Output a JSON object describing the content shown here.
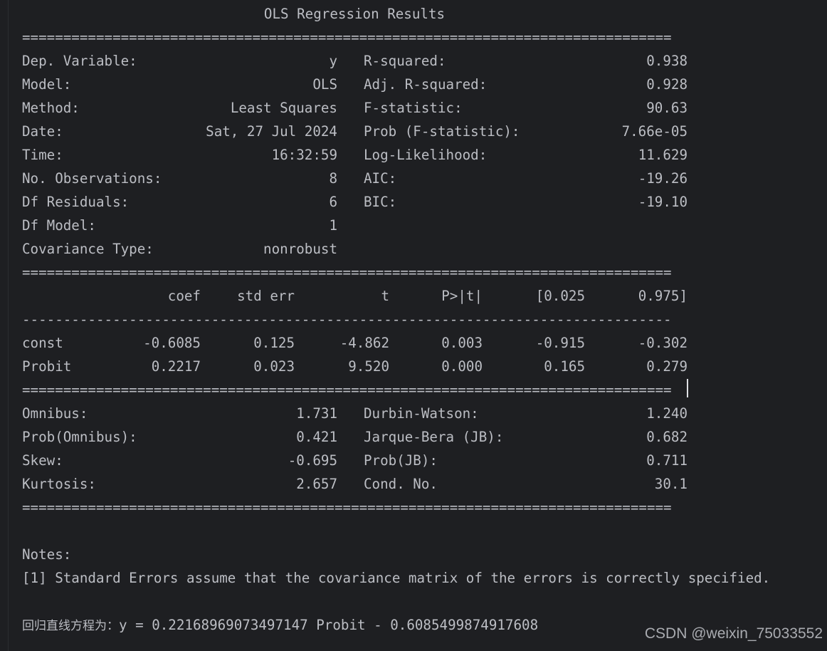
{
  "colors": {
    "background": "#1e1f22",
    "text": "#bcbec4",
    "gutter": "#2b2d30",
    "cursor": "#dfe1e5",
    "watermark": "#a9abb0"
  },
  "title": "OLS Regression Results",
  "separator_double": "===============================================================================",
  "separator_single": "-------------------------------------------------------------------------------",
  "summary": {
    "left": [
      {
        "label": "Dep. Variable:",
        "value": "y"
      },
      {
        "label": "Model:",
        "value": "OLS"
      },
      {
        "label": "Method:",
        "value": "Least Squares"
      },
      {
        "label": "Date:",
        "value": "Sat, 27 Jul 2024"
      },
      {
        "label": "Time:",
        "value": "16:32:59"
      },
      {
        "label": "No. Observations:",
        "value": "8"
      },
      {
        "label": "Df Residuals:",
        "value": "6"
      },
      {
        "label": "Df Model:",
        "value": "1"
      },
      {
        "label": "Covariance Type:",
        "value": "nonrobust"
      }
    ],
    "right": [
      {
        "label": "R-squared:",
        "value": "0.938"
      },
      {
        "label": "Adj. R-squared:",
        "value": "0.928"
      },
      {
        "label": "F-statistic:",
        "value": "90.63"
      },
      {
        "label": "Prob (F-statistic):",
        "value": "7.66e-05"
      },
      {
        "label": "Log-Likelihood:",
        "value": "11.629"
      },
      {
        "label": "AIC:",
        "value": "-19.26"
      },
      {
        "label": "BIC:",
        "value": "-19.10"
      }
    ]
  },
  "coef_table": {
    "headers": [
      "coef",
      "std err",
      "t",
      "P>|t|",
      "[0.025",
      "0.975]"
    ],
    "rows": [
      {
        "name": "const",
        "values": [
          "-0.6085",
          "0.125",
          "-4.862",
          "0.003",
          "-0.915",
          "-0.302"
        ]
      },
      {
        "name": "Probit",
        "values": [
          "0.2217",
          "0.023",
          "9.520",
          "0.000",
          "0.165",
          "0.279"
        ]
      }
    ]
  },
  "diagnostics": {
    "left": [
      {
        "label": "Omnibus:",
        "value": "1.731"
      },
      {
        "label": "Prob(Omnibus):",
        "value": "0.421"
      },
      {
        "label": "Skew:",
        "value": "-0.695"
      },
      {
        "label": "Kurtosis:",
        "value": "2.657"
      }
    ],
    "right": [
      {
        "label": "Durbin-Watson:",
        "value": "1.240"
      },
      {
        "label": "Jarque-Bera (JB):",
        "value": "0.682"
      },
      {
        "label": "Prob(JB):",
        "value": "0.711"
      },
      {
        "label": "Cond. No.",
        "value": "30.1"
      }
    ]
  },
  "notes": {
    "heading": "Notes:",
    "line1": "[1] Standard Errors assume that the covariance matrix of the errors is correctly specified."
  },
  "equation": {
    "prefix": "回归直线方程为：",
    "formula": "y = 0.22168969073497147 Probit - 0.6085499874917608"
  },
  "watermark": "CSDN @weixin_75033552"
}
